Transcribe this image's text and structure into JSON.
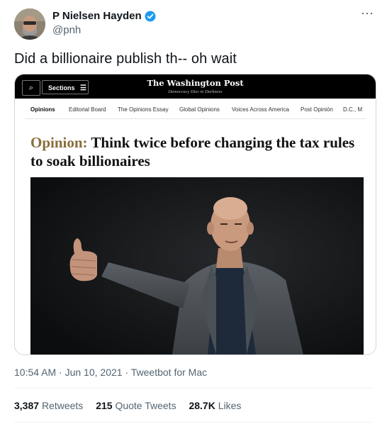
{
  "author": {
    "display_name": "P Nielsen Hayden",
    "handle": "@pnh",
    "verified": true
  },
  "more_icon": "⋯",
  "tweet_text": "Did a billionaire publish th-- oh wait",
  "embedded_screenshot": {
    "topbar": {
      "search_icon": "⌕",
      "sections_label": "Sections",
      "sections_icon": "☰",
      "logo": "The Washington Post",
      "tagline": "Democracy Dies in Darkness"
    },
    "nav": [
      "Opinions",
      "Editorial Board",
      "The Opinions Essay",
      "Global Opinions",
      "Voices Across America",
      "Post Opinión",
      "D.C., M"
    ],
    "headline_kicker": "Opinion:",
    "headline_rest": "Think twice before changing the tax rules to soak billionaires"
  },
  "meta": {
    "time": "10:54 AM",
    "date": "Jun 10, 2021",
    "client": "Tweetbot for Mac",
    "time_line": "10:54 AM · Jun 10, 2021 · Tweetbot for Mac"
  },
  "stats": {
    "retweets_count": "3,387",
    "retweets_label": "Retweets",
    "quotes_count": "215",
    "quotes_label": "Quote Tweets",
    "likes_count": "28.7K",
    "likes_label": "Likes"
  },
  "colors": {
    "verified_blue": "#1d9bf0",
    "kicker_gold": "#8a6d3b",
    "secondary_text": "#536471"
  }
}
